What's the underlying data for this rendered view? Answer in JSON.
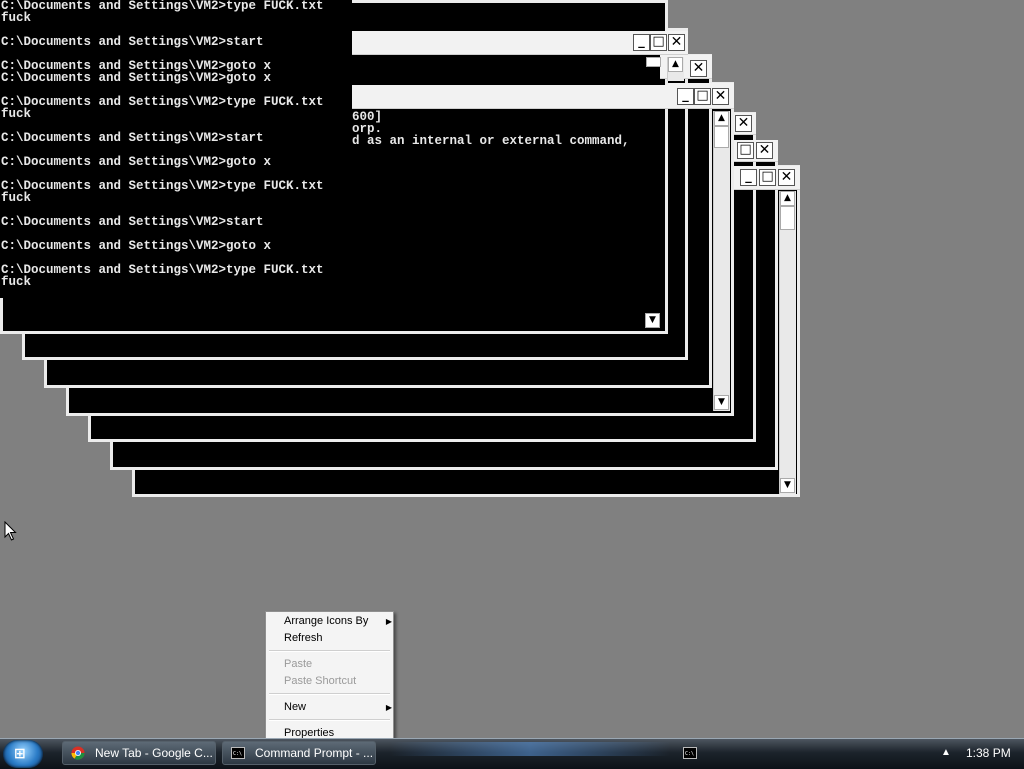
{
  "console": {
    "lines": [
      "C:\\Documents and Settings\\VM2>type FUCK.txt",
      "fuck",
      "",
      "C:\\Documents and Settings\\VM2>start",
      "",
      "C:\\Documents and Settings\\VM2>goto x",
      "C:\\Documents and Settings\\VM2>goto x",
      "",
      "C:\\Documents and Settings\\VM2>type FUCK.txt",
      "fuck",
      "",
      "C:\\Documents and Settings\\VM2>start",
      "",
      "C:\\Documents and Settings\\VM2>goto x",
      "",
      "C:\\Documents and Settings\\VM2>type FUCK.txt",
      "fuck",
      "",
      "C:\\Documents and Settings\\VM2>start",
      "",
      "C:\\Documents and Settings\\VM2>goto x",
      "",
      "C:\\Documents and Settings\\VM2>type FUCK.txt",
      "fuck"
    ]
  },
  "background_fragments": [
    "600]",
    "orp.",
    "d as an internal or external command,"
  ],
  "window_buttons": {
    "minimize": "_",
    "maximize": "□",
    "close": "✕"
  },
  "context_menu": {
    "items": [
      {
        "label": "Arrange Icons By",
        "enabled": true,
        "submenu": true
      },
      {
        "label": "Refresh",
        "enabled": true,
        "submenu": false
      },
      {
        "label": "Paste",
        "enabled": false,
        "submenu": false
      },
      {
        "label": "Paste Shortcut",
        "enabled": false,
        "submenu": false
      },
      {
        "label": "New",
        "enabled": true,
        "submenu": true
      },
      {
        "label": "Properties",
        "enabled": true,
        "submenu": false
      }
    ]
  },
  "taskbar": {
    "start_icon": "windows-orb-icon",
    "buttons": [
      {
        "label": "New Tab - Google C...",
        "icon": "chrome-icon"
      },
      {
        "label": "Command Prompt - ...",
        "icon": "cmd-icon"
      }
    ],
    "quicklaunch_icon": "cmd-icon",
    "tray_arrow": "▲",
    "clock": "1:38 PM"
  },
  "colors": {
    "desktop": "#808080",
    "console_bg": "#000000",
    "console_text": "#e8e8e8"
  }
}
